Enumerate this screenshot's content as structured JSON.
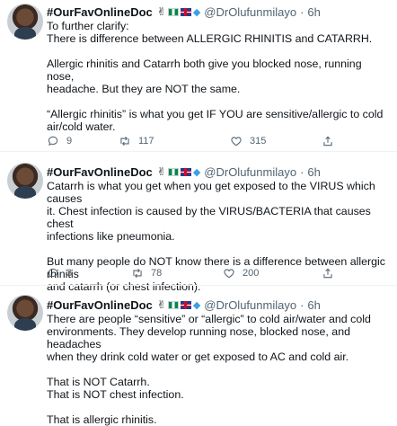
{
  "tweets": [
    {
      "name": "#OurFavOnlineDoc",
      "handle": "@DrOlufunmilayo",
      "time": "6h",
      "badge_emojis": [
        "hand-victory",
        "flag-nigeria",
        "flag-uk",
        "blue-diamond"
      ],
      "paragraphs": [
        "To further clarify:",
        "There is difference between ALLERGIC RHINITIS and CATARRH.",
        "",
        "Allergic rhinitis and Catarrh both give you blocked nose, running nose,",
        "headache. But they are NOT the same.",
        "",
        "“Allergic rhinitis” is what you get IF YOU are sensitive/allergic to cold",
        "air/cold water."
      ],
      "replies": "9",
      "retweets": "117",
      "likes": "315"
    },
    {
      "name": "#OurFavOnlineDoc",
      "handle": "@DrOlufunmilayo",
      "time": "6h",
      "badge_emojis": [
        "hand-victory",
        "flag-nigeria",
        "flag-uk",
        "blue-diamond"
      ],
      "paragraphs": [
        "Catarrh is what you get when you get exposed to the VIRUS which causes",
        "it. Chest infection is caused by the VIRUS/BACTERIA that causes chest",
        "infections like pneumonia.",
        "",
        "But many people do NOT know there is a difference between allergic rhinitis",
        "and catarrh (or chest infection)."
      ],
      "replies": "3",
      "retweets": "78",
      "likes": "200"
    },
    {
      "name": "#OurFavOnlineDoc",
      "handle": "@DrOlufunmilayo",
      "time": "6h",
      "badge_emojis": [
        "hand-victory",
        "flag-nigeria",
        "flag-uk",
        "blue-diamond"
      ],
      "paragraphs": [
        "There are people “sensitive” or “allergic” to cold air/water and cold",
        "environments. They develop running nose, blocked nose, and headaches",
        "when they drink cold water or get exposed to AC and cold air.",
        "",
        "That is NOT Catarrh.",
        "That is NOT chest infection.",
        "",
        "That is allergic rhinitis."
      ]
    }
  ],
  "dot": "·"
}
